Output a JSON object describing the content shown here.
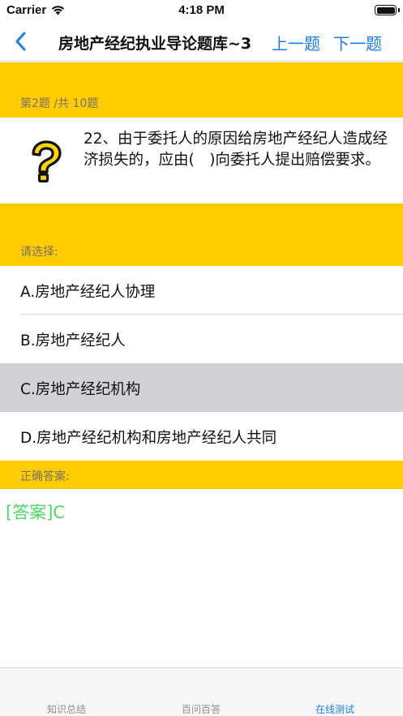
{
  "status_bar": {
    "carrier": "Carrier",
    "time": "4:18 PM"
  },
  "nav": {
    "title": "房地产经纪执业导论题库~3",
    "prev_label": "上一题",
    "next_label": "下一题"
  },
  "question": {
    "progress": "第2题 /共 10题",
    "text": "22、由于委托人的原因给房地产经纪人造成经济损失的，应由(　)向委托人提出赔偿要求。",
    "icon": "question-mark-icon"
  },
  "choices": {
    "header": "请选择:",
    "options": [
      {
        "label": "A.房地产经纪人协理",
        "selected": false
      },
      {
        "label": "B.房地产经纪人",
        "selected": false
      },
      {
        "label": "C.房地产经纪机构",
        "selected": true
      },
      {
        "label": "D.房地产经纪机构和房地产经纪人共同",
        "selected": false
      }
    ]
  },
  "answer": {
    "header": "正确答案:",
    "text": "[答案]C"
  },
  "tabs": [
    {
      "label": "知识总结",
      "active": false
    },
    {
      "label": "百问百答",
      "active": false
    },
    {
      "label": "在线测试",
      "active": true
    }
  ],
  "colors": {
    "accent": "#1a7cf5",
    "band": "#ffcc00",
    "answer": "#4cd964",
    "selected_row": "#d1d1d6"
  }
}
